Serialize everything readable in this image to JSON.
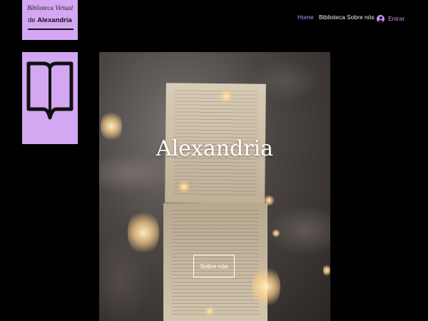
{
  "logo": {
    "line1": "Biblioteca Virtual",
    "line2_prefix": "de ",
    "line2_bold": "Alexandria"
  },
  "book_icon": {
    "name": "open-book-icon",
    "color": "#111111",
    "background": "#d3a7f2"
  },
  "nav": {
    "items": [
      {
        "label": "Home",
        "active": true
      },
      {
        "label": "Biblioteca",
        "active": false
      },
      {
        "label": "Sobre nós",
        "active": false
      }
    ],
    "login_label": "Entrar",
    "login_icon": "user-avatar-icon",
    "accent_color": "#c790f2"
  },
  "hero": {
    "title": "Alexandria",
    "button_label": "Sobre nós"
  }
}
